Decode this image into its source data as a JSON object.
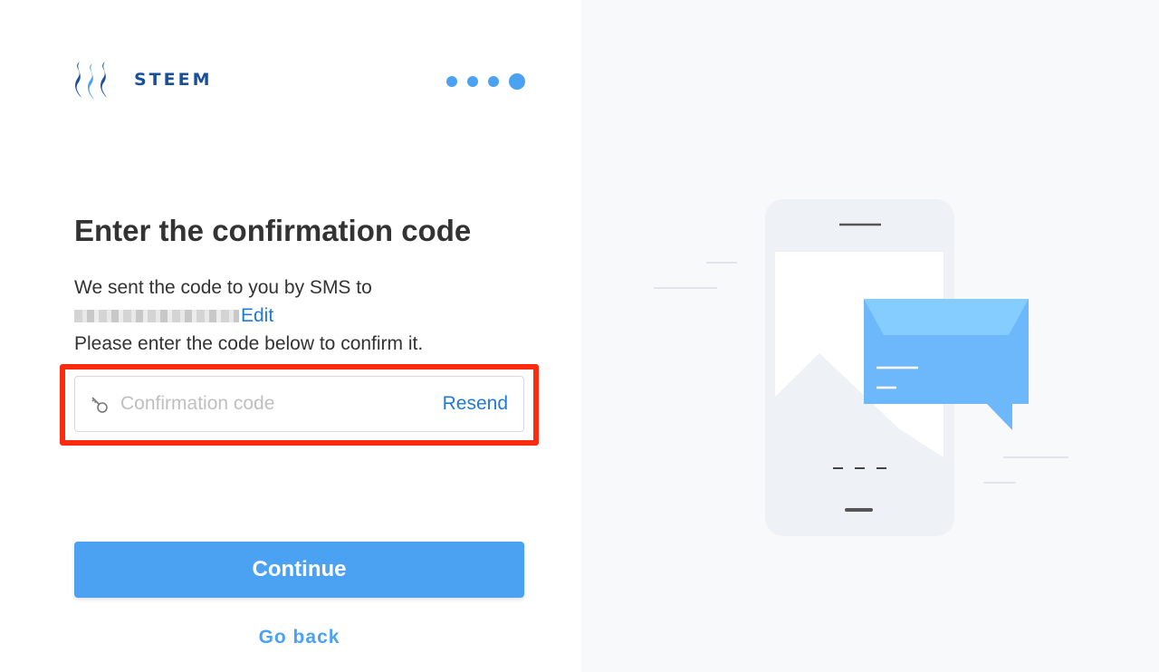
{
  "brand": {
    "name": "STEEM"
  },
  "steps": {
    "total": 4,
    "current": 4
  },
  "page": {
    "title": "Enter the confirmation code",
    "desc_line1": "We sent the code to you by SMS to",
    "edit_label": "Edit",
    "desc_line3": "Please enter the code below to confirm it."
  },
  "code_input": {
    "placeholder": "Confirmation code",
    "value": "",
    "icon": "key-icon"
  },
  "resend_label": "Resend",
  "continue_label": "Continue",
  "goback_label": "Go back",
  "colors": {
    "accent": "#4ba2f2",
    "link": "#1f7ad8",
    "brand": "#1a5099",
    "highlight": "#fa2b0f",
    "panel_bg": "#f8f9fa"
  }
}
